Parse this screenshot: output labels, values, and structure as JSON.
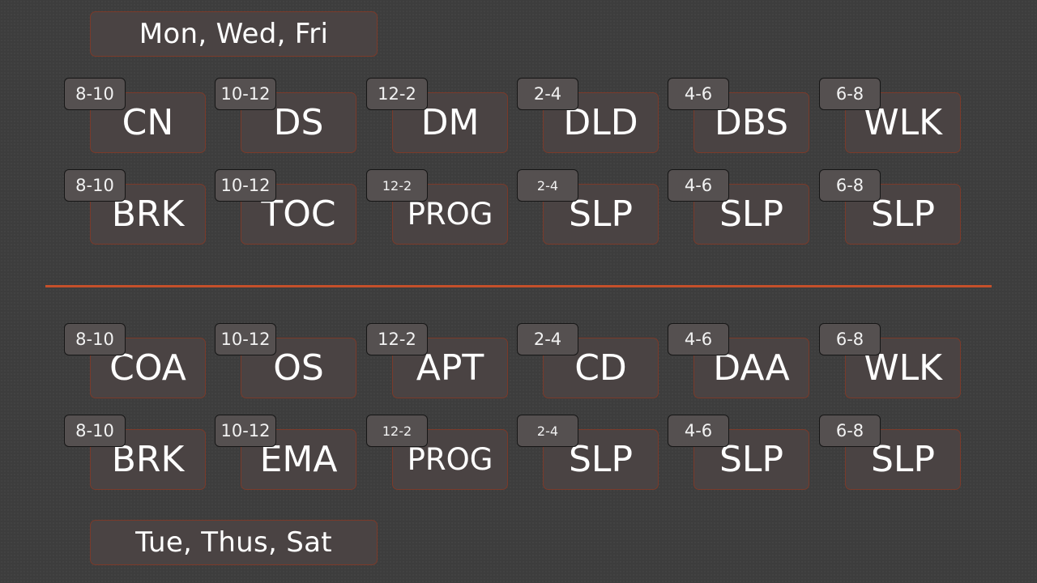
{
  "labels": {
    "top": "Mon, Wed, Fri",
    "bottom": "Tue, Thus, Sat"
  },
  "group_a": {
    "row1": [
      {
        "time": "8-10",
        "activity": "CN"
      },
      {
        "time": "10-12",
        "activity": "DS"
      },
      {
        "time": "12-2",
        "activity": "DM"
      },
      {
        "time": "2-4",
        "activity": "DLD"
      },
      {
        "time": "4-6",
        "activity": "DBS"
      },
      {
        "time": "6-8",
        "activity": "WLK"
      }
    ],
    "row2": [
      {
        "time": "8-10",
        "activity": "BRK"
      },
      {
        "time": "10-12",
        "activity": "TOC"
      },
      {
        "time": "12-2",
        "activity": "PROG"
      },
      {
        "time": "2-4",
        "activity": "SLP"
      },
      {
        "time": "4-6",
        "activity": "SLP"
      },
      {
        "time": "6-8",
        "activity": "SLP"
      }
    ]
  },
  "group_b": {
    "row1": [
      {
        "time": "8-10",
        "activity": "COA"
      },
      {
        "time": "10-12",
        "activity": "OS"
      },
      {
        "time": "12-2",
        "activity": "APT"
      },
      {
        "time": "2-4",
        "activity": "CD"
      },
      {
        "time": "4-6",
        "activity": "DAA"
      },
      {
        "time": "6-8",
        "activity": "WLK"
      }
    ],
    "row2": [
      {
        "time": "8-10",
        "activity": "BRK"
      },
      {
        "time": "10-12",
        "activity": "EMA"
      },
      {
        "time": "12-2",
        "activity": "PROG"
      },
      {
        "time": "2-4",
        "activity": "SLP"
      },
      {
        "time": "4-6",
        "activity": "SLP"
      },
      {
        "time": "6-8",
        "activity": "SLP"
      }
    ]
  },
  "colors": {
    "background": "#3d3d3d",
    "box_fill": "#4a4343",
    "box_border": "#7a3a2a",
    "badge_fill": "#555050",
    "divider": "#c5502a",
    "text": "#ffffff"
  }
}
